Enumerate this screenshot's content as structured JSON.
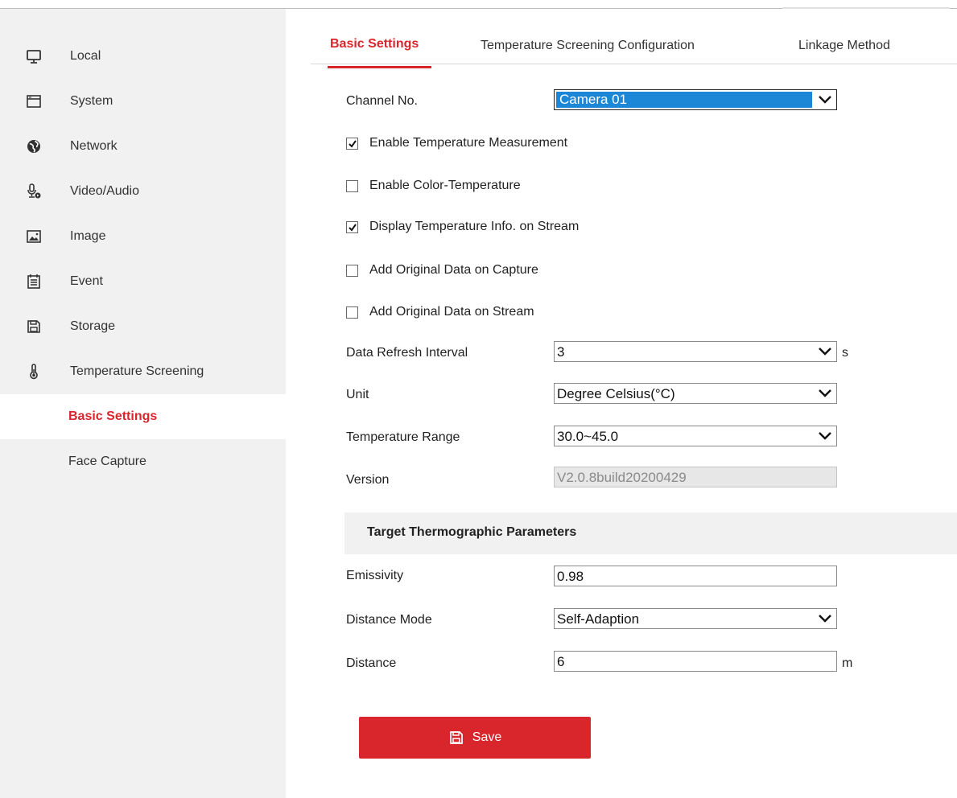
{
  "sidebar": {
    "items": [
      {
        "label": "Local",
        "icon": "monitor-icon"
      },
      {
        "label": "System",
        "icon": "window-icon"
      },
      {
        "label": "Network",
        "icon": "globe-icon"
      },
      {
        "label": "Video/Audio",
        "icon": "microphone-icon"
      },
      {
        "label": "Image",
        "icon": "image-icon"
      },
      {
        "label": "Event",
        "icon": "calendar-icon"
      },
      {
        "label": "Storage",
        "icon": "floppy-icon"
      },
      {
        "label": "Temperature Screening",
        "icon": "thermometer-icon"
      }
    ],
    "sub_items": [
      {
        "label": "Basic Settings",
        "active": true
      },
      {
        "label": "Face Capture",
        "active": false
      }
    ]
  },
  "tabs": [
    {
      "label": "Basic Settings",
      "active": true
    },
    {
      "label": "Temperature Screening Configuration",
      "active": false
    },
    {
      "label": "Linkage Method",
      "active": false
    }
  ],
  "form": {
    "channel_label": "Channel No.",
    "channel_value": "Camera 01",
    "checkboxes": [
      {
        "label": "Enable Temperature Measurement",
        "checked": true
      },
      {
        "label": "Enable Color-Temperature",
        "checked": false
      },
      {
        "label": "Display Temperature Info. on Stream",
        "checked": true
      },
      {
        "label": "Add Original Data on Capture",
        "checked": false
      },
      {
        "label": "Add Original Data on Stream",
        "checked": false
      }
    ],
    "refresh_label": "Data Refresh Interval",
    "refresh_value": "3",
    "refresh_unit": "s",
    "unit_label": "Unit",
    "unit_value": "Degree Celsius(°C)",
    "range_label": "Temperature Range",
    "range_value": "30.0~45.0",
    "version_label": "Version",
    "version_value": "V2.0.8build20200429"
  },
  "thermo": {
    "section_title": "Target Thermographic Parameters",
    "emissivity_label": "Emissivity",
    "emissivity_value": "0.98",
    "distance_mode_label": "Distance Mode",
    "distance_mode_value": "Self-Adaption",
    "distance_label": "Distance",
    "distance_value": "6",
    "distance_unit": "m"
  },
  "save_label": "Save",
  "colors": {
    "accent": "#d9262c",
    "select_highlight": "#1b87d6",
    "sidebar_bg": "#f1f1f1"
  }
}
